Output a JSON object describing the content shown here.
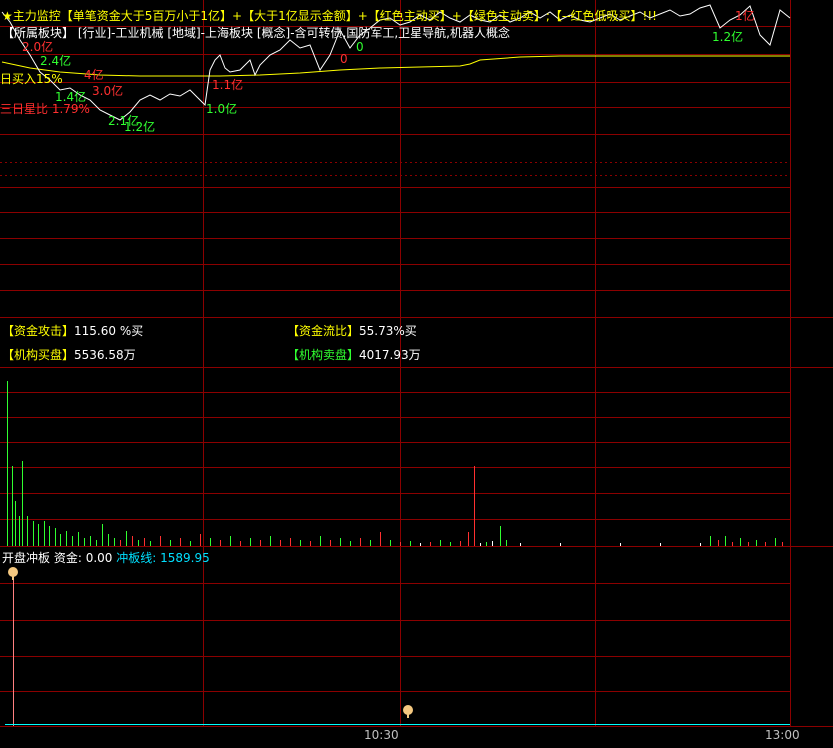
{
  "header": {
    "star_title": "★主力监控",
    "legend_items": [
      "【单笔资金大于5百万小于1亿】+【大于1亿显示金额】+【红色主动买】+【绿色主动卖】;【--红色低吸买】!!!"
    ],
    "sector_line": "【所属板块】 [行业]-工业机械 [地域]-上海板块 [概念]-含可转债,国防军工,卫星导航,机器人概念"
  },
  "price_panel": {
    "annotations": [
      {
        "text": "2.0亿",
        "color": "#ff3030"
      },
      {
        "text": "2.4亿",
        "color": "#30ff30"
      },
      {
        "text": "4亿",
        "color": "#ff3030"
      },
      {
        "text": "3.0亿",
        "color": "#ff3030"
      },
      {
        "text": "1.4亿",
        "color": "#30ff30"
      },
      {
        "text": "2.1亿",
        "color": "#30ff30"
      },
      {
        "text": "1.2亿",
        "color": "#30ff30"
      },
      {
        "text": "1.1亿",
        "color": "#ff3030"
      },
      {
        "text": "1.0亿",
        "color": "#30ff30"
      },
      {
        "text": "1.2亿",
        "color": "#30ff30"
      },
      {
        "text": "1亿",
        "color": "#ff3030"
      },
      {
        "text": "0",
        "color": "#30ff30"
      },
      {
        "text": "0",
        "color": "#ff3030"
      }
    ],
    "left_labels": [
      {
        "text": "日买入15%",
        "color": "#ffff00"
      },
      {
        "text": "三日星比 1.79%",
        "color": "#ff3030"
      }
    ]
  },
  "fund_panel": {
    "attack_label": "【资金攻击】",
    "attack_value": "115.60 %买",
    "flow_label": "【资金流比】",
    "flow_value": "55.73%买",
    "inst_buy_label": "【机构买盘】",
    "inst_buy_value": "5536.58万",
    "inst_sell_label": "【机构卖盘】",
    "inst_sell_value": "4017.93万"
  },
  "bottom_panel": {
    "title": "开盘冲板",
    "fund_label": "资金: 0.00",
    "line_label": "冲板线: 1589.95"
  },
  "time_axis": {
    "labels": [
      "10:30",
      "13:00"
    ]
  },
  "colors": {
    "grid": "#8b0000",
    "price_line": "#ffffff",
    "avg_line": "#ffff00",
    "buy_bar": "#ff3030",
    "sell_bar": "#30ff30",
    "cyan": "#00e0ff"
  }
}
